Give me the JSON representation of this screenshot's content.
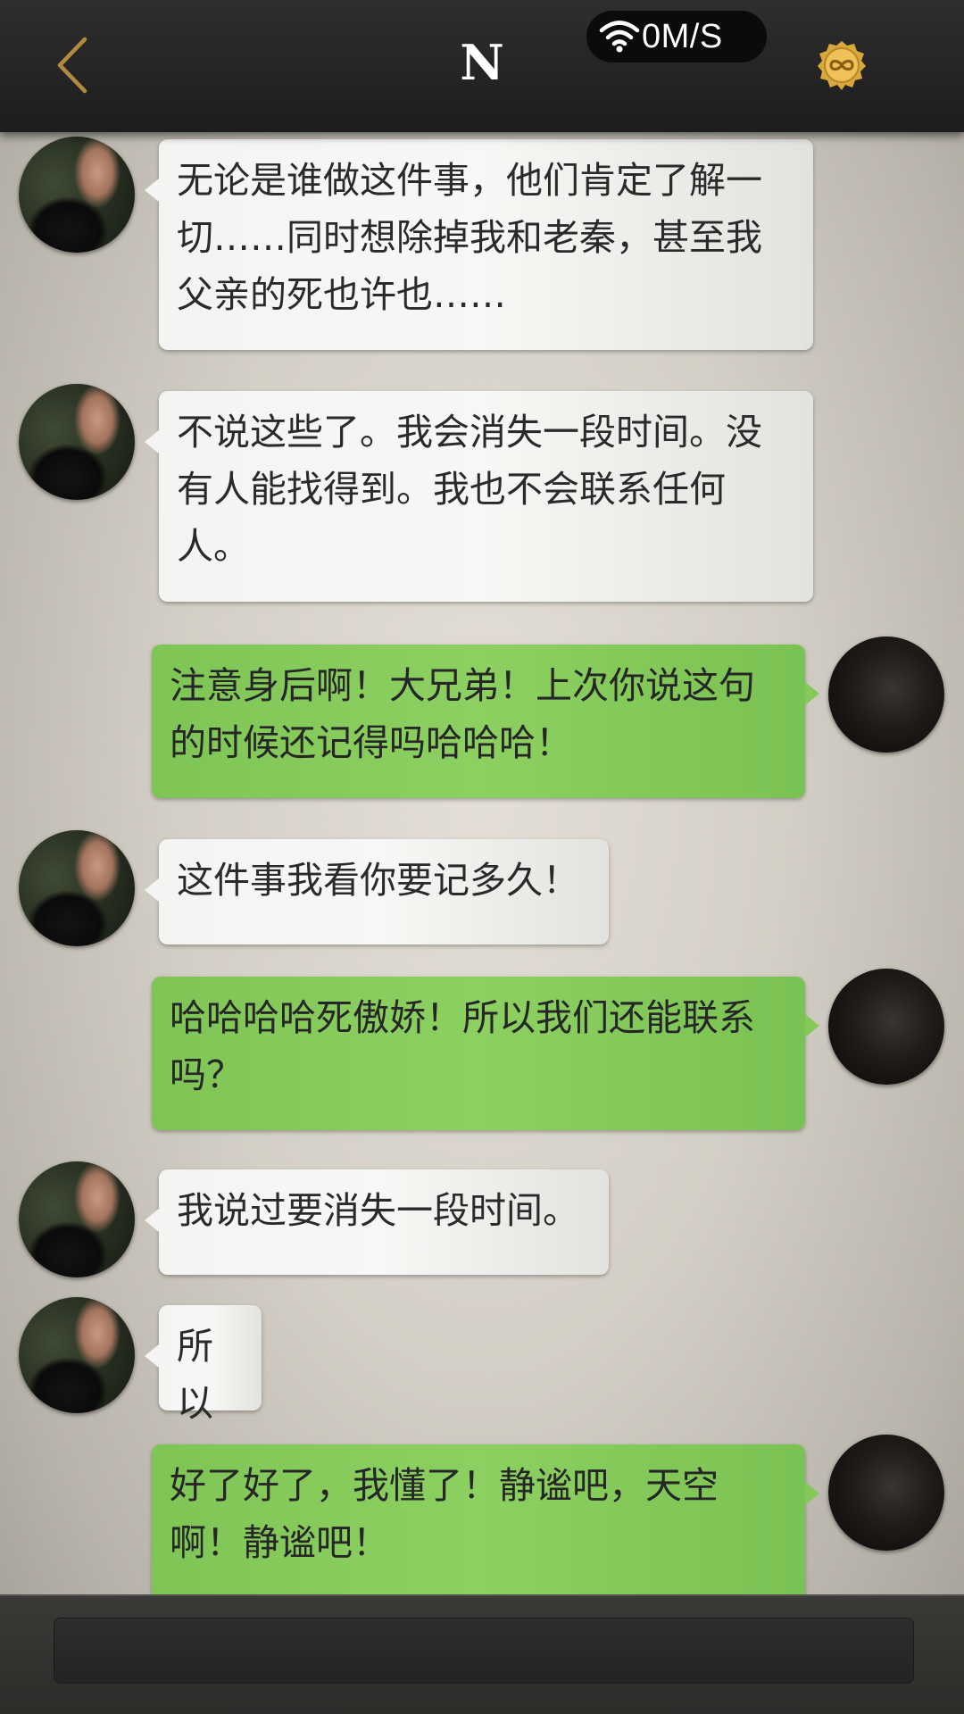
{
  "header": {
    "title": "N",
    "network_speed": "0M/S",
    "icons": {
      "back": "back-chevron-icon",
      "wifi": "wifi-icon",
      "coin": "infinity-coin-icon"
    },
    "accent_color": "#b08a3e"
  },
  "messages": [
    {
      "side": "in",
      "text": "无论是谁做这件事，他们肯定了解一切……同时想除掉我和老秦，甚至我父亲的死也许也……"
    },
    {
      "side": "in",
      "text": "不说这些了。我会消失一段时间。没有人能找得到。我也不会联系任何人。"
    },
    {
      "side": "out",
      "text": "注意身后啊！大兄弟！上次你说这句的时候还记得吗哈哈哈！"
    },
    {
      "side": "in",
      "text": "这件事我看你要记多久！"
    },
    {
      "side": "out",
      "text": "哈哈哈哈死傲娇！所以我们还能联系吗？"
    },
    {
      "side": "in",
      "text": "我说过要消失一段时间。"
    },
    {
      "side": "in",
      "text": "所以"
    },
    {
      "side": "out",
      "text": "好了好了，我懂了！静谧吧，天空啊！静谧吧！"
    }
  ],
  "input": {
    "value": ""
  },
  "colors": {
    "incoming_bubble": "#f4f4f2",
    "outgoing_bubble": "#86cb5b",
    "top_bar": "#262626",
    "bottom_bar": "#33322f"
  }
}
